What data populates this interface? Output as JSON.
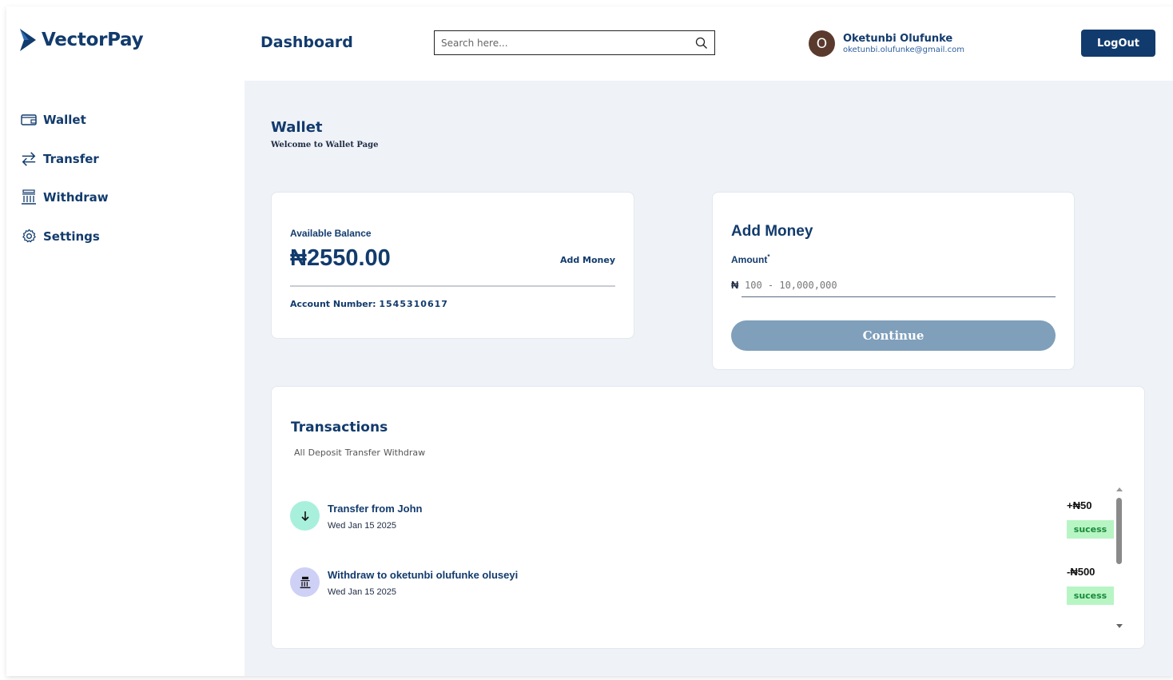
{
  "app": {
    "name": "VectorPay"
  },
  "sidebar": {
    "items": [
      {
        "label": "Wallet",
        "icon": "wallet-icon"
      },
      {
        "label": "Transfer",
        "icon": "transfer-icon"
      },
      {
        "label": "Withdraw",
        "icon": "bank-icon"
      },
      {
        "label": "Settings",
        "icon": "gear-icon"
      }
    ]
  },
  "header": {
    "title": "Dashboard",
    "search_placeholder": "Search here...",
    "user": {
      "initial": "O",
      "name": "Oketunbi Olufunke",
      "email": "oketunbi.olufunke@gmail.com"
    },
    "logout_label": "LogOut"
  },
  "wallet": {
    "title": "Wallet",
    "subtitle": "Welcome to Wallet Page",
    "balance_label": "Available Balance",
    "balance": "₦2550.00",
    "add_money_link": "Add Money",
    "account_label": "Account Number:",
    "account_number": "1545310617"
  },
  "add_money": {
    "title": "Add Money",
    "amount_label": "Amount",
    "required_mark": "*",
    "currency_symbol": "₦",
    "amount_placeholder": "100 - 10,000,000",
    "continue_label": "Continue"
  },
  "transactions": {
    "title": "Transactions",
    "filters": [
      "All",
      "Deposit",
      "Transfer",
      "Withdraw"
    ],
    "items": [
      {
        "name": "Transfer from John",
        "date": "Wed Jan 15 2025",
        "amount": "+₦50",
        "status": "sucess",
        "icon": "arrow-down-icon",
        "icon_bg": "#a8f0dc"
      },
      {
        "name": "Withdraw to oketunbi olufunke oluseyi",
        "date": "Wed Jan 15 2025",
        "amount": "-₦500",
        "status": "sucess",
        "icon": "bank-icon",
        "icon_bg": "#cfd0f5"
      }
    ]
  },
  "colors": {
    "primary": "#123b6d",
    "background": "#eff2f7",
    "continue_button": "#7f9fbb",
    "status_bg": "#b8f5c4",
    "avatar": "#5b3a2e"
  }
}
